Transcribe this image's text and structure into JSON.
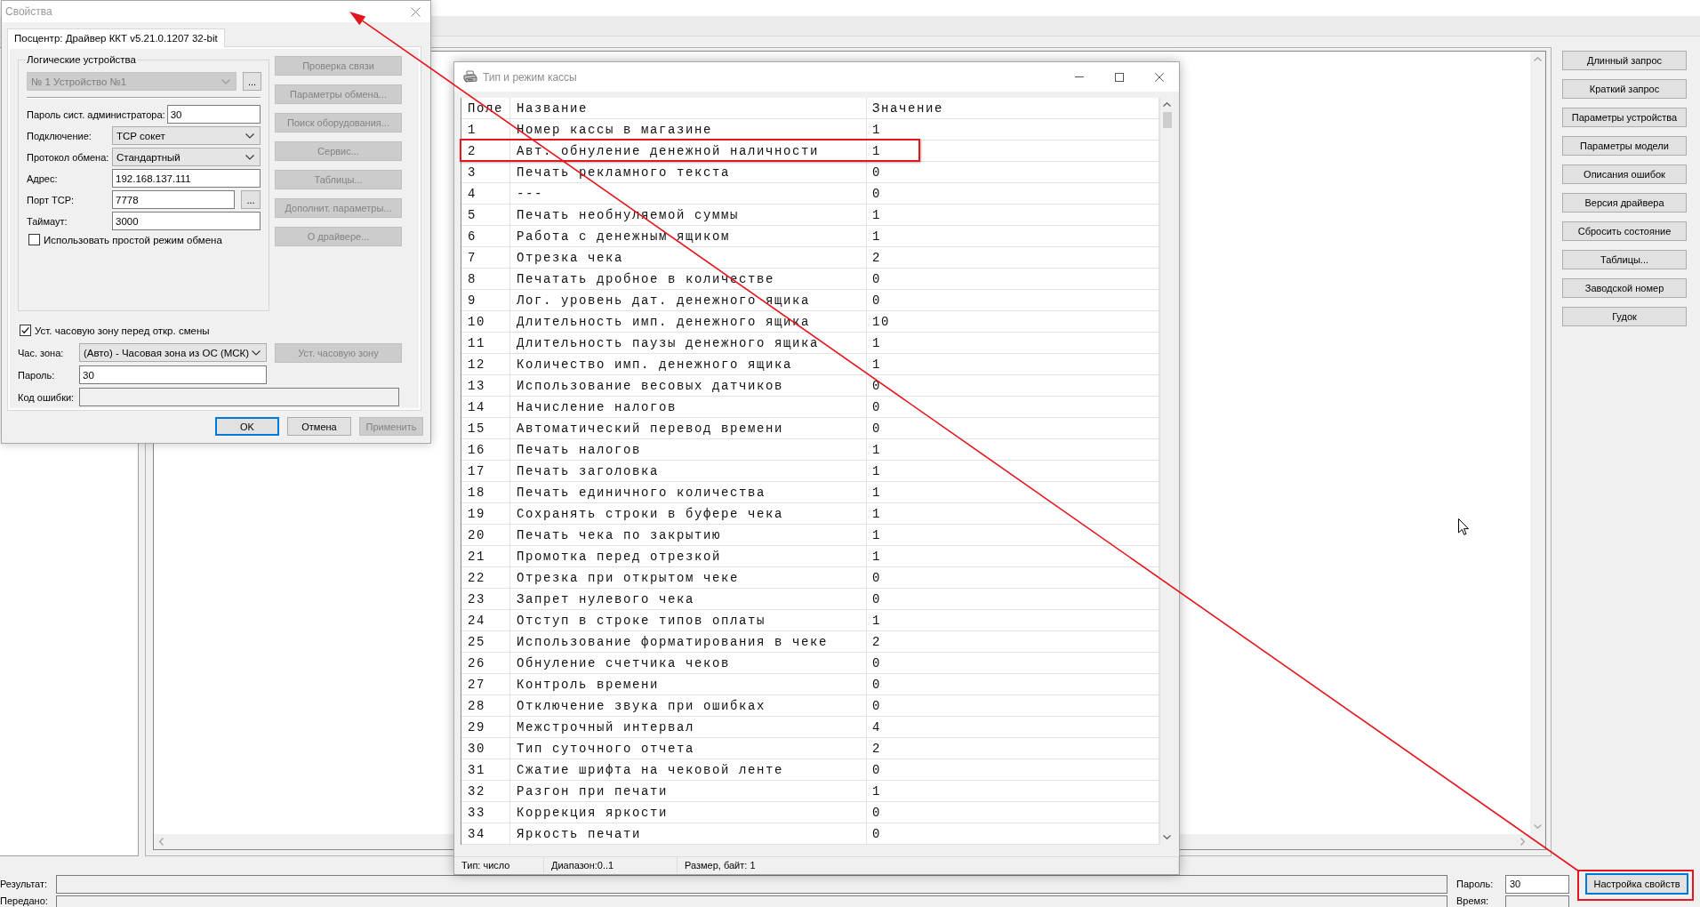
{
  "properties_dialog": {
    "title": "Свойства",
    "tab": {
      "label": "Посцентр: Драйвер ККТ v5.21.0.1207 32-bit",
      "selected": true
    },
    "logical_devices": {
      "label": "Логические устройства",
      "device": {
        "value": "№ 1 Устройство №1",
        "disabled": true
      },
      "browse_button": "..."
    },
    "fields": [
      {
        "kind": "text",
        "label": "Пароль сист. администратора:",
        "value": "30"
      },
      {
        "kind": "select",
        "label": "Подключение:",
        "value": "TCP сокет"
      },
      {
        "kind": "select",
        "label": "Протокол обмена:",
        "value": "Стандартный"
      },
      {
        "kind": "text",
        "label": "Адрес:",
        "value": "192.168.137.111"
      },
      {
        "kind": "text_browse",
        "label": "Порт TCP:",
        "value": "7778",
        "button": "..."
      },
      {
        "kind": "text",
        "label": "Таймаут:",
        "value": "3000"
      }
    ],
    "simple_mode": {
      "label": "Использовать простой режим обмена",
      "checked": false
    },
    "side_buttons": [
      {
        "label": "Проверка связи",
        "disabled": true
      },
      {
        "label": "Параметры обмена...",
        "disabled": true
      },
      {
        "label": "Поиск оборудования...",
        "disabled": true
      },
      {
        "label": "Сервис...",
        "disabled": true
      },
      {
        "label": "Таблицы...",
        "disabled": true
      },
      {
        "label": "Дополнит. параметры...",
        "disabled": true
      },
      {
        "label": "О драйвере...",
        "disabled": true
      }
    ],
    "timezone_checkbox": {
      "label": "Уст. часовую зону перед откр. смены",
      "checked": true
    },
    "timezone": {
      "label": "Час. зона:",
      "value": "(Авто) - Часовая зона из ОС (МСК)"
    },
    "timezone_button": {
      "label": "Уст. часовую зону",
      "disabled": true
    },
    "password": {
      "label": "Пароль:",
      "value": "30"
    },
    "error_code": {
      "label": "Код ошибки:"
    },
    "buttons": [
      {
        "label": "OK",
        "default": true,
        "disabled": false
      },
      {
        "label": "Отмена",
        "default": false,
        "disabled": false
      },
      {
        "label": "Применить",
        "default": false,
        "disabled": true
      }
    ]
  },
  "table_window": {
    "title": "Тип и режим кассы",
    "columns": [
      "Поле",
      "Название",
      "Значение"
    ],
    "rows": [
      {
        "field": "1",
        "name": "Номер кассы в магазине",
        "value": "1",
        "highlighted": false
      },
      {
        "field": "2",
        "name": "Авт. обнуление денежной наличности",
        "value": "1",
        "highlighted": true
      },
      {
        "field": "3",
        "name": "Печать рекламного текста",
        "value": "0",
        "highlighted": false
      },
      {
        "field": "4",
        "name": "---",
        "value": "0",
        "highlighted": false
      },
      {
        "field": "5",
        "name": "Печать необнуляемой суммы",
        "value": "1",
        "highlighted": false
      },
      {
        "field": "6",
        "name": "Работа с денежным ящиком",
        "value": "1",
        "highlighted": false
      },
      {
        "field": "7",
        "name": "Отрезка чека",
        "value": "2",
        "highlighted": false
      },
      {
        "field": "8",
        "name": "Печатать дробное в количестве",
        "value": "0",
        "highlighted": false
      },
      {
        "field": "9",
        "name": "Лог. уровень дат. денежного ящика",
        "value": "0",
        "highlighted": false
      },
      {
        "field": "10",
        "name": "Длительность имп. денежного ящика",
        "value": "10",
        "highlighted": false
      },
      {
        "field": "11",
        "name": "Длительность паузы денежного ящика",
        "value": "1",
        "highlighted": false
      },
      {
        "field": "12",
        "name": "Количество имп. денежного ящика",
        "value": "1",
        "highlighted": false
      },
      {
        "field": "13",
        "name": "Использование весовых датчиков",
        "value": "0",
        "highlighted": false
      },
      {
        "field": "14",
        "name": "Начисление налогов",
        "value": "0",
        "highlighted": false
      },
      {
        "field": "15",
        "name": "Автоматический перевод времени",
        "value": "0",
        "highlighted": false
      },
      {
        "field": "16",
        "name": "Печать налогов",
        "value": "1",
        "highlighted": false
      },
      {
        "field": "17",
        "name": "Печать заголовка",
        "value": "1",
        "highlighted": false
      },
      {
        "field": "18",
        "name": "Печать единичного количества",
        "value": "1",
        "highlighted": false
      },
      {
        "field": "19",
        "name": "Сохранять строки в буфере чека",
        "value": "1",
        "highlighted": false
      },
      {
        "field": "20",
        "name": "Печать чека по закрытию",
        "value": "1",
        "highlighted": false
      },
      {
        "field": "21",
        "name": "Промотка перед отрезкой",
        "value": "1",
        "highlighted": false
      },
      {
        "field": "22",
        "name": "Отрезка при открытом чеке",
        "value": "0",
        "highlighted": false
      },
      {
        "field": "23",
        "name": "Запрет нулевого чека",
        "value": "0",
        "highlighted": false
      },
      {
        "field": "24",
        "name": "Отступ в строке типов оплаты",
        "value": "1",
        "highlighted": false
      },
      {
        "field": "25",
        "name": "Использование форматирования в чеке",
        "value": "2",
        "highlighted": false
      },
      {
        "field": "26",
        "name": "Обнуление счетчика чеков",
        "value": "0",
        "highlighted": false
      },
      {
        "field": "27",
        "name": "Контроль времени",
        "value": "0",
        "highlighted": false
      },
      {
        "field": "28",
        "name": "Отключение звука при ошибках",
        "value": "0",
        "highlighted": false
      },
      {
        "field": "29",
        "name": "Межстрочный интервал",
        "value": "4",
        "highlighted": false
      },
      {
        "field": "30",
        "name": "Тип суточного отчета",
        "value": "2",
        "highlighted": false
      },
      {
        "field": "31",
        "name": "Сжатие шрифта на чековой ленте",
        "value": "0",
        "highlighted": false
      },
      {
        "field": "32",
        "name": "Разгон при печати",
        "value": "1",
        "highlighted": false
      },
      {
        "field": "33",
        "name": "Коррекция яркости",
        "value": "0",
        "highlighted": false
      },
      {
        "field": "34",
        "name": "Яркость печати",
        "value": "0",
        "highlighted": false
      }
    ],
    "status_bar": [
      "Тип: число",
      "Диапазон:0..1",
      "Размер, байт: 1"
    ]
  },
  "main_window": {
    "right_buttons": [
      {
        "label": "Длинный запрос"
      },
      {
        "label": "Краткий запрос"
      },
      {
        "label": "Параметры устройства"
      },
      {
        "label": "Параметры модели"
      },
      {
        "label": "Описания ошибок"
      },
      {
        "label": "Версия драйвера"
      },
      {
        "label": "Сбросить состояние"
      },
      {
        "label": "Таблицы..."
      },
      {
        "label": "Заводской номер"
      },
      {
        "label": "Гудок"
      }
    ],
    "bottom": {
      "result_label": "Результат:",
      "password_label": "Пароль:",
      "password_value": "30",
      "settings_button": {
        "label": "Настройка свойств",
        "default": true,
        "highlighted": true
      },
      "transferred_label": "Передано:",
      "time_label": "Время:"
    }
  },
  "annotation_arrow": true
}
